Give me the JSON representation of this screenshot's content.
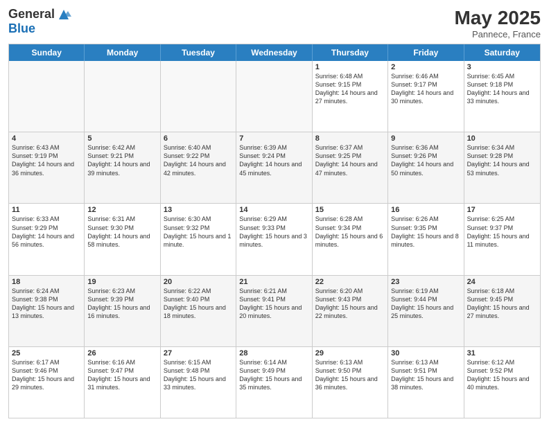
{
  "header": {
    "logo_general": "General",
    "logo_blue": "Blue",
    "month_year": "May 2025",
    "location": "Pannece, France"
  },
  "weekdays": [
    "Sunday",
    "Monday",
    "Tuesday",
    "Wednesday",
    "Thursday",
    "Friday",
    "Saturday"
  ],
  "rows": [
    [
      {
        "day": "",
        "text": ""
      },
      {
        "day": "",
        "text": ""
      },
      {
        "day": "",
        "text": ""
      },
      {
        "day": "",
        "text": ""
      },
      {
        "day": "1",
        "text": "Sunrise: 6:48 AM\nSunset: 9:15 PM\nDaylight: 14 hours and 27 minutes."
      },
      {
        "day": "2",
        "text": "Sunrise: 6:46 AM\nSunset: 9:17 PM\nDaylight: 14 hours and 30 minutes."
      },
      {
        "day": "3",
        "text": "Sunrise: 6:45 AM\nSunset: 9:18 PM\nDaylight: 14 hours and 33 minutes."
      }
    ],
    [
      {
        "day": "4",
        "text": "Sunrise: 6:43 AM\nSunset: 9:19 PM\nDaylight: 14 hours and 36 minutes."
      },
      {
        "day": "5",
        "text": "Sunrise: 6:42 AM\nSunset: 9:21 PM\nDaylight: 14 hours and 39 minutes."
      },
      {
        "day": "6",
        "text": "Sunrise: 6:40 AM\nSunset: 9:22 PM\nDaylight: 14 hours and 42 minutes."
      },
      {
        "day": "7",
        "text": "Sunrise: 6:39 AM\nSunset: 9:24 PM\nDaylight: 14 hours and 45 minutes."
      },
      {
        "day": "8",
        "text": "Sunrise: 6:37 AM\nSunset: 9:25 PM\nDaylight: 14 hours and 47 minutes."
      },
      {
        "day": "9",
        "text": "Sunrise: 6:36 AM\nSunset: 9:26 PM\nDaylight: 14 hours and 50 minutes."
      },
      {
        "day": "10",
        "text": "Sunrise: 6:34 AM\nSunset: 9:28 PM\nDaylight: 14 hours and 53 minutes."
      }
    ],
    [
      {
        "day": "11",
        "text": "Sunrise: 6:33 AM\nSunset: 9:29 PM\nDaylight: 14 hours and 56 minutes."
      },
      {
        "day": "12",
        "text": "Sunrise: 6:31 AM\nSunset: 9:30 PM\nDaylight: 14 hours and 58 minutes."
      },
      {
        "day": "13",
        "text": "Sunrise: 6:30 AM\nSunset: 9:32 PM\nDaylight: 15 hours and 1 minute."
      },
      {
        "day": "14",
        "text": "Sunrise: 6:29 AM\nSunset: 9:33 PM\nDaylight: 15 hours and 3 minutes."
      },
      {
        "day": "15",
        "text": "Sunrise: 6:28 AM\nSunset: 9:34 PM\nDaylight: 15 hours and 6 minutes."
      },
      {
        "day": "16",
        "text": "Sunrise: 6:26 AM\nSunset: 9:35 PM\nDaylight: 15 hours and 8 minutes."
      },
      {
        "day": "17",
        "text": "Sunrise: 6:25 AM\nSunset: 9:37 PM\nDaylight: 15 hours and 11 minutes."
      }
    ],
    [
      {
        "day": "18",
        "text": "Sunrise: 6:24 AM\nSunset: 9:38 PM\nDaylight: 15 hours and 13 minutes."
      },
      {
        "day": "19",
        "text": "Sunrise: 6:23 AM\nSunset: 9:39 PM\nDaylight: 15 hours and 16 minutes."
      },
      {
        "day": "20",
        "text": "Sunrise: 6:22 AM\nSunset: 9:40 PM\nDaylight: 15 hours and 18 minutes."
      },
      {
        "day": "21",
        "text": "Sunrise: 6:21 AM\nSunset: 9:41 PM\nDaylight: 15 hours and 20 minutes."
      },
      {
        "day": "22",
        "text": "Sunrise: 6:20 AM\nSunset: 9:43 PM\nDaylight: 15 hours and 22 minutes."
      },
      {
        "day": "23",
        "text": "Sunrise: 6:19 AM\nSunset: 9:44 PM\nDaylight: 15 hours and 25 minutes."
      },
      {
        "day": "24",
        "text": "Sunrise: 6:18 AM\nSunset: 9:45 PM\nDaylight: 15 hours and 27 minutes."
      }
    ],
    [
      {
        "day": "25",
        "text": "Sunrise: 6:17 AM\nSunset: 9:46 PM\nDaylight: 15 hours and 29 minutes."
      },
      {
        "day": "26",
        "text": "Sunrise: 6:16 AM\nSunset: 9:47 PM\nDaylight: 15 hours and 31 minutes."
      },
      {
        "day": "27",
        "text": "Sunrise: 6:15 AM\nSunset: 9:48 PM\nDaylight: 15 hours and 33 minutes."
      },
      {
        "day": "28",
        "text": "Sunrise: 6:14 AM\nSunset: 9:49 PM\nDaylight: 15 hours and 35 minutes."
      },
      {
        "day": "29",
        "text": "Sunrise: 6:13 AM\nSunset: 9:50 PM\nDaylight: 15 hours and 36 minutes."
      },
      {
        "day": "30",
        "text": "Sunrise: 6:13 AM\nSunset: 9:51 PM\nDaylight: 15 hours and 38 minutes."
      },
      {
        "day": "31",
        "text": "Sunrise: 6:12 AM\nSunset: 9:52 PM\nDaylight: 15 hours and 40 minutes."
      }
    ]
  ]
}
